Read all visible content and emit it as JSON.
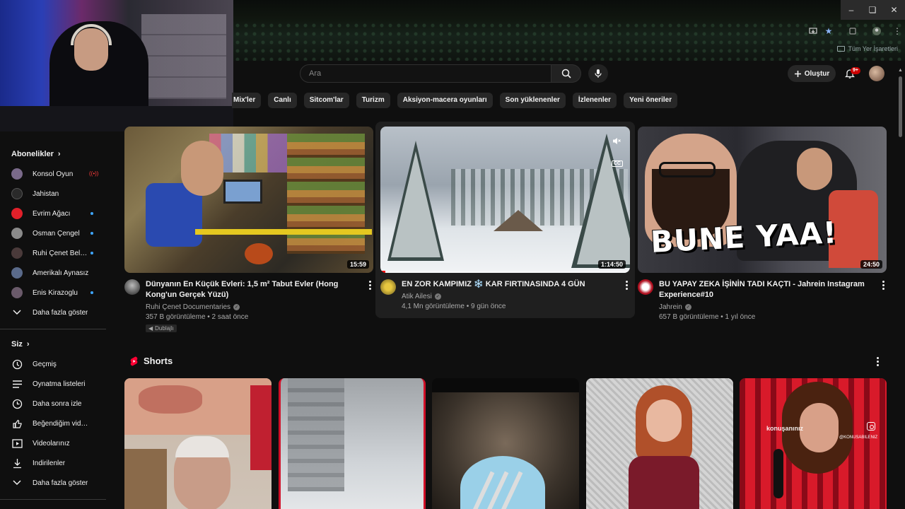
{
  "browser": {
    "bookmarks_label": "Tüm Yer İşaretleri",
    "window_controls": [
      "minimize",
      "restore",
      "close"
    ]
  },
  "header": {
    "search_placeholder": "Ara",
    "create_label": "Oluştur",
    "notification_count": "9+"
  },
  "chips": [
    "Mix'ler",
    "Canlı",
    "Sitcom'lar",
    "Turizm",
    "Aksiyon-macera oyunları",
    "Son yüklenenler",
    "İzlenenler",
    "Yeni öneriler"
  ],
  "sidebar": {
    "subscriptions_title": "Abonelikler",
    "subscriptions": [
      {
        "label": "Konsol Oyun",
        "status": "live",
        "color": "#7a6a8a"
      },
      {
        "label": "Jahistan",
        "status": "",
        "color": "#2a2a2a"
      },
      {
        "label": "Evrim Ağacı",
        "status": "new",
        "color": "#e0202a"
      },
      {
        "label": "Osman Çengel",
        "status": "new",
        "color": "#8a8a8a"
      },
      {
        "label": "Ruhi Çenet Belge...",
        "status": "new",
        "color": "#4a3a3a"
      },
      {
        "label": "Amerikalı Aynasız",
        "status": "",
        "color": "#5a6a8a"
      },
      {
        "label": "Enis Kirazoglu",
        "status": "new",
        "color": "#6a5a6a"
      }
    ],
    "subscriptions_more": "Daha fazla göster",
    "you_title": "Siz",
    "you_items": [
      {
        "label": "Geçmiş",
        "icon": "history-icon"
      },
      {
        "label": "Oynatma listeleri",
        "icon": "playlist-icon"
      },
      {
        "label": "Daha sonra izle",
        "icon": "watch-later-icon"
      },
      {
        "label": "Beğendiğim videolar",
        "icon": "like-icon"
      },
      {
        "label": "Videolarınız",
        "icon": "your-videos-icon"
      },
      {
        "label": "İndirilenler",
        "icon": "download-icon"
      }
    ],
    "you_more": "Daha fazla göster"
  },
  "videos": [
    {
      "title": "Dünyanın En Küçük Evleri: 1,5 m² Tabut Evler (Hong Kong'un Gerçek Yüzü)",
      "channel": "Ruhi Çenet Documentaries",
      "stats": "357 B görüntüleme • 2 saat önce",
      "duration": "15:59",
      "badge": "Dublajlı"
    },
    {
      "title": "EN ZOR KAMPIMIZ ❄️ KAR FIRTINASINDA 4 GÜN",
      "channel": "Atik Ailesi",
      "stats": "4,1 Mn görüntüleme • 9 gün önce",
      "duration": "1:14:50",
      "cc": "CC"
    },
    {
      "title": "BU YAPAY ZEKA İŞİNİN TADI KAÇTI - Jahrein Instagram Experience#10",
      "channel": "Jahrein",
      "stats": "657 B görüntüleme • 1 yıl önce",
      "duration": "24:50",
      "thumb_text": "BUNE YAA!"
    }
  ],
  "shorts": {
    "title": "Shorts",
    "overlay_caption": "konuşanınız",
    "overlay_handle": "@KONUSABILENIZ"
  }
}
